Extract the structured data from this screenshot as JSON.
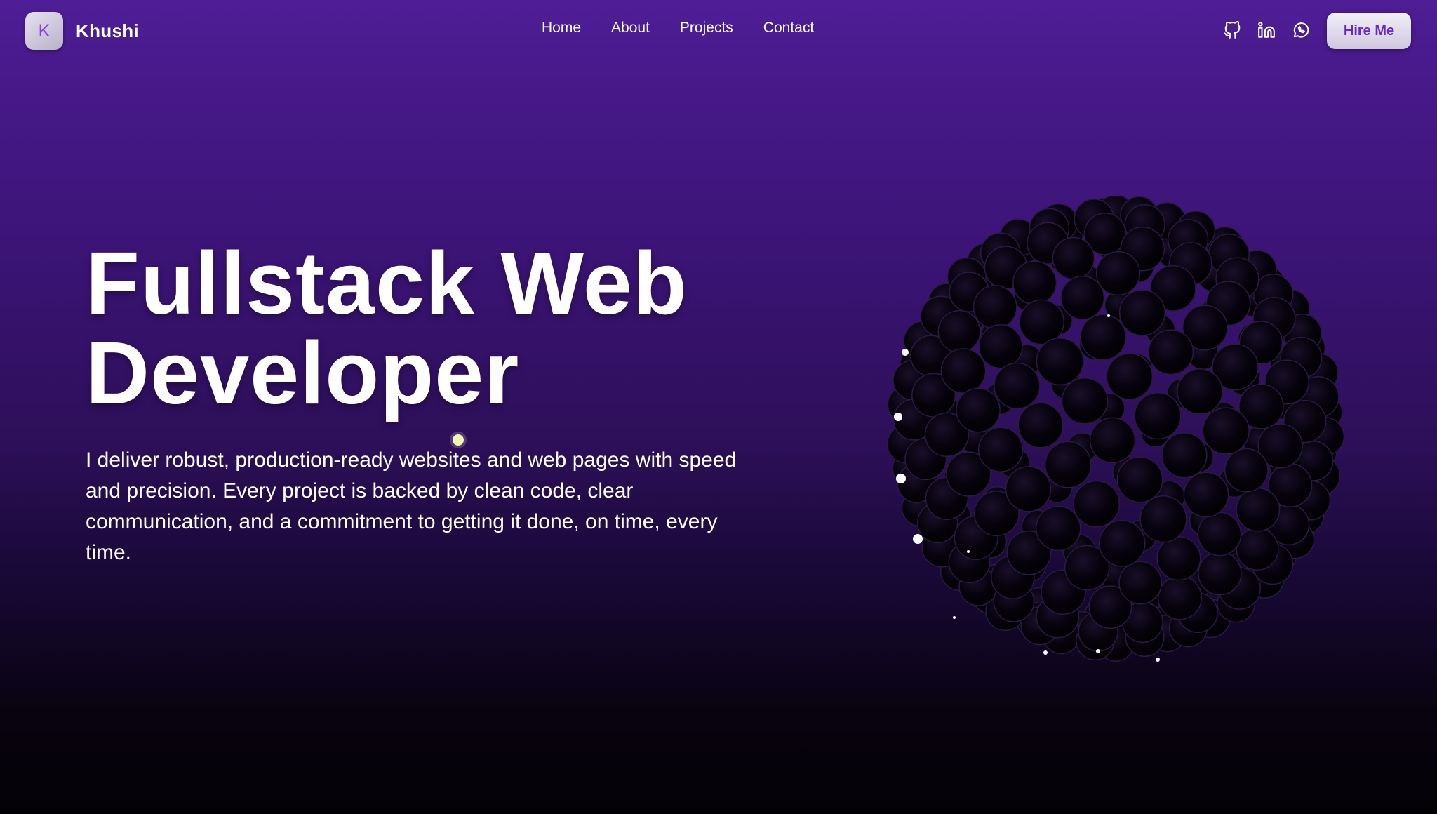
{
  "brand": {
    "initial": "K",
    "name": "Khushi"
  },
  "nav": {
    "links": [
      "Home",
      "About",
      "Projects",
      "Contact"
    ],
    "social_icons": [
      "github-icon",
      "linkedin-icon",
      "whatsapp-icon"
    ],
    "cta_label": "Hire Me"
  },
  "hero": {
    "title_line1": "Fullstack Web",
    "title_line2": "Developer",
    "description": "I deliver robust, production-ready websites and web pages with speed and precision. Every project is backed by clean code, clear communication, and a commitment to getting it done, on time, every time."
  },
  "colors": {
    "background_top": "#4f1e96",
    "background_bottom": "#040106",
    "accent": "#6a25d0",
    "logo_letter": "#8a3fe0",
    "cursor_dot": "#f1f7a8"
  }
}
